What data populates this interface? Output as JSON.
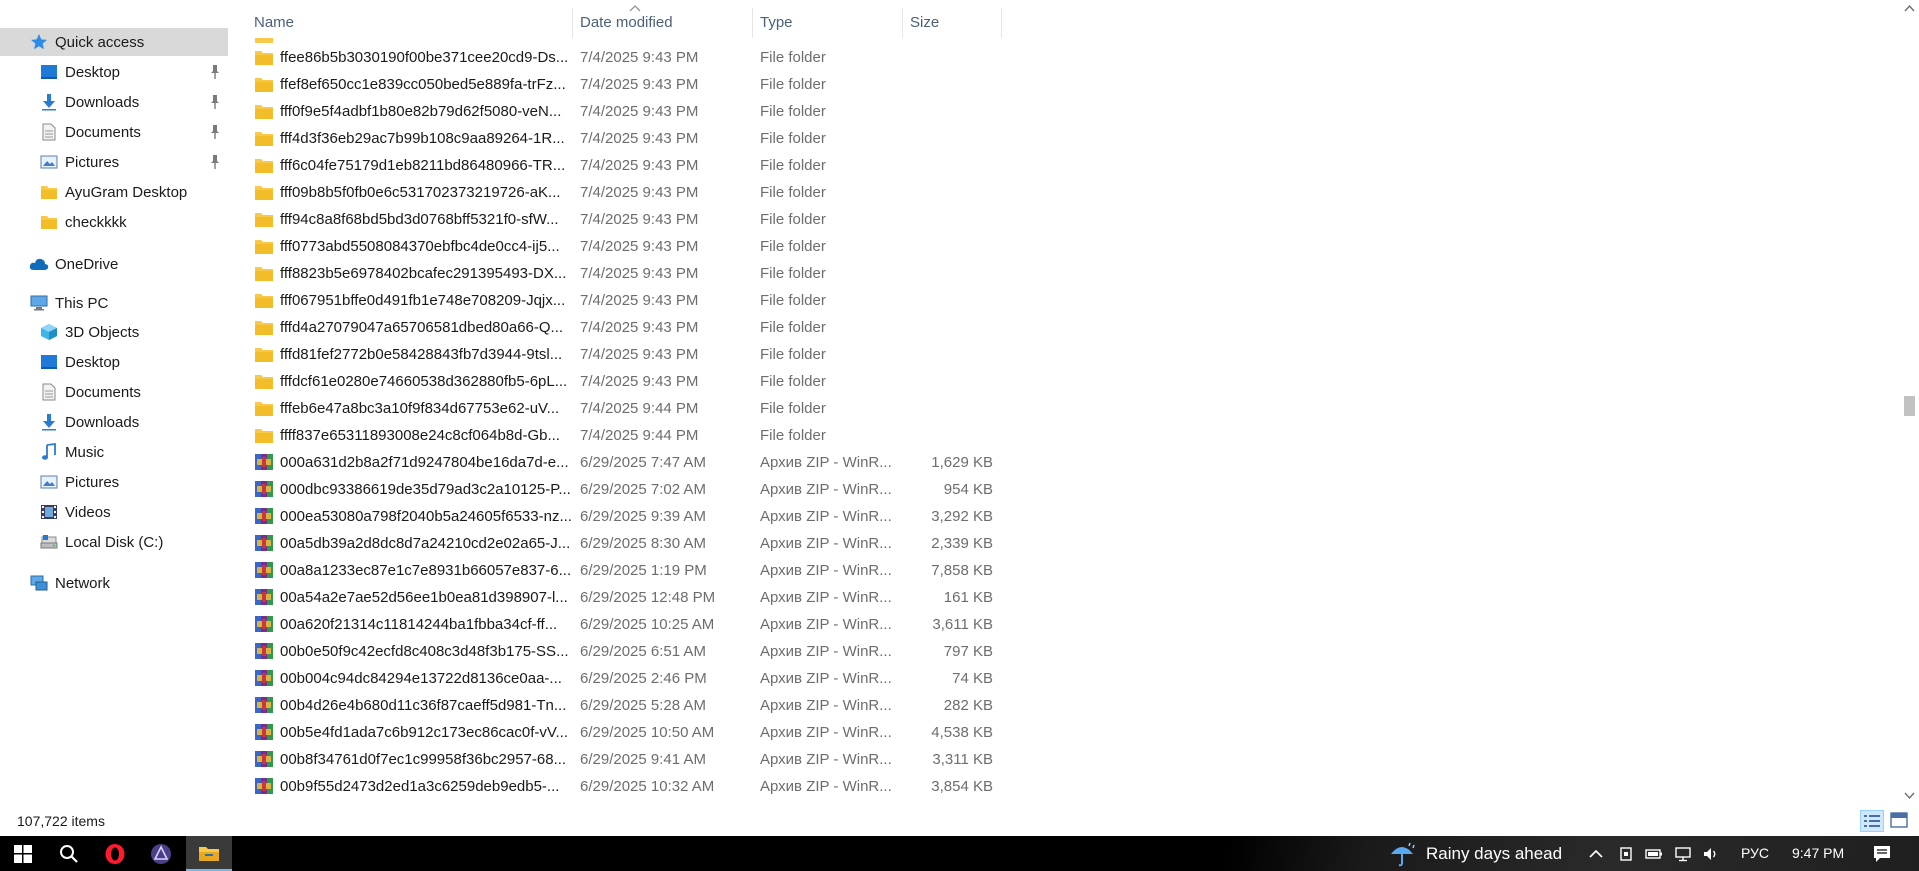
{
  "sidebar": {
    "quick_access": "Quick access",
    "quick_items": [
      {
        "label": "Desktop",
        "icon": "desktop-icon",
        "pinned": true
      },
      {
        "label": "Downloads",
        "icon": "downloads-icon",
        "pinned": true
      },
      {
        "label": "Documents",
        "icon": "documents-icon",
        "pinned": true
      },
      {
        "label": "Pictures",
        "icon": "pictures-icon",
        "pinned": true
      },
      {
        "label": "AyuGram Desktop",
        "icon": "folder-icon",
        "pinned": false
      },
      {
        "label": "checkkkk",
        "icon": "folder-icon",
        "pinned": false
      }
    ],
    "onedrive": "OneDrive",
    "this_pc": "This PC",
    "pc_items": [
      {
        "label": "3D Objects",
        "icon": "3d-objects-icon"
      },
      {
        "label": "Desktop",
        "icon": "desktop-icon"
      },
      {
        "label": "Documents",
        "icon": "documents-icon"
      },
      {
        "label": "Downloads",
        "icon": "downloads-icon"
      },
      {
        "label": "Music",
        "icon": "music-icon"
      },
      {
        "label": "Pictures",
        "icon": "pictures-icon"
      },
      {
        "label": "Videos",
        "icon": "videos-icon"
      },
      {
        "label": "Local Disk (C:)",
        "icon": "disk-icon"
      }
    ],
    "network": "Network"
  },
  "columns": {
    "name": "Name",
    "date": "Date modified",
    "type": "Type",
    "size": "Size"
  },
  "files": [
    {
      "name": "ffee86b5b3030190f00be371cee20cd9-Ds...",
      "date": "7/4/2025 9:43 PM",
      "type": "File folder",
      "size": "",
      "kind": "folder"
    },
    {
      "name": "ffef8ef650cc1e839cc050bed5e889fa-trFz...",
      "date": "7/4/2025 9:43 PM",
      "type": "File folder",
      "size": "",
      "kind": "folder"
    },
    {
      "name": "fff0f9e5f4adbf1b80e82b79d62f5080-veN...",
      "date": "7/4/2025 9:43 PM",
      "type": "File folder",
      "size": "",
      "kind": "folder"
    },
    {
      "name": "fff4d3f36eb29ac7b99b108c9aa89264-1R...",
      "date": "7/4/2025 9:43 PM",
      "type": "File folder",
      "size": "",
      "kind": "folder"
    },
    {
      "name": "fff6c04fe75179d1eb8211bd86480966-TR...",
      "date": "7/4/2025 9:43 PM",
      "type": "File folder",
      "size": "",
      "kind": "folder"
    },
    {
      "name": "fff09b8b5f0fb0e6c531702373219726-aK...",
      "date": "7/4/2025 9:43 PM",
      "type": "File folder",
      "size": "",
      "kind": "folder"
    },
    {
      "name": "fff94c8a8f68bd5bd3d0768bff5321f0-sfW...",
      "date": "7/4/2025 9:43 PM",
      "type": "File folder",
      "size": "",
      "kind": "folder"
    },
    {
      "name": "fff0773abd5508084370ebfbc4de0cc4-ij5...",
      "date": "7/4/2025 9:43 PM",
      "type": "File folder",
      "size": "",
      "kind": "folder"
    },
    {
      "name": "fff8823b5e6978402bcafec291395493-DX...",
      "date": "7/4/2025 9:43 PM",
      "type": "File folder",
      "size": "",
      "kind": "folder"
    },
    {
      "name": "fff067951bffe0d491fb1e748e708209-Jqjx...",
      "date": "7/4/2025 9:43 PM",
      "type": "File folder",
      "size": "",
      "kind": "folder"
    },
    {
      "name": "fffd4a27079047a65706581dbed80a66-Q...",
      "date": "7/4/2025 9:43 PM",
      "type": "File folder",
      "size": "",
      "kind": "folder"
    },
    {
      "name": "fffd81fef2772b0e58428843fb7d3944-9tsl...",
      "date": "7/4/2025 9:43 PM",
      "type": "File folder",
      "size": "",
      "kind": "folder"
    },
    {
      "name": "fffdcf61e0280e74660538d362880fb5-6pL...",
      "date": "7/4/2025 9:43 PM",
      "type": "File folder",
      "size": "",
      "kind": "folder"
    },
    {
      "name": "fffeb6e47a8bc3a10f9f834d67753e62-uV...",
      "date": "7/4/2025 9:44 PM",
      "type": "File folder",
      "size": "",
      "kind": "folder"
    },
    {
      "name": "ffff837e65311893008e24c8cf064b8d-Gb...",
      "date": "7/4/2025 9:44 PM",
      "type": "File folder",
      "size": "",
      "kind": "folder"
    },
    {
      "name": "000a631d2b8a2f71d9247804be16da7d-e...",
      "date": "6/29/2025 7:47 AM",
      "type": "Архив ZIP - WinR...",
      "size": "1,629 KB",
      "kind": "zip"
    },
    {
      "name": "000dbc93386619de35d79ad3c2a10125-P...",
      "date": "6/29/2025 7:02 AM",
      "type": "Архив ZIP - WinR...",
      "size": "954 KB",
      "kind": "zip"
    },
    {
      "name": "000ea53080a798f2040b5a24605f6533-nz...",
      "date": "6/29/2025 9:39 AM",
      "type": "Архив ZIP - WinR...",
      "size": "3,292 KB",
      "kind": "zip"
    },
    {
      "name": "00a5db39a2d8dc8d7a24210cd2e02a65-J...",
      "date": "6/29/2025 8:30 AM",
      "type": "Архив ZIP - WinR...",
      "size": "2,339 KB",
      "kind": "zip"
    },
    {
      "name": "00a8a1233ec87e1c7e8931b66057e837-6...",
      "date": "6/29/2025 1:19 PM",
      "type": "Архив ZIP - WinR...",
      "size": "7,858 KB",
      "kind": "zip"
    },
    {
      "name": "00a54a2e7ae52d56ee1b0ea81d398907-l...",
      "date": "6/29/2025 12:48 PM",
      "type": "Архив ZIP - WinR...",
      "size": "161 KB",
      "kind": "zip"
    },
    {
      "name": "00a620f21314c11814244ba1fbba34cf-ff...",
      "date": "6/29/2025 10:25 AM",
      "type": "Архив ZIP - WinR...",
      "size": "3,611 KB",
      "kind": "zip"
    },
    {
      "name": "00b0e50f9c42ecfd8c408c3d48f3b175-SS...",
      "date": "6/29/2025 6:51 AM",
      "type": "Архив ZIP - WinR...",
      "size": "797 KB",
      "kind": "zip"
    },
    {
      "name": "00b004c94dc84294e13722d8136ce0aa-...",
      "date": "6/29/2025 2:46 PM",
      "type": "Архив ZIP - WinR...",
      "size": "74 KB",
      "kind": "zip"
    },
    {
      "name": "00b4d26e4b680d11c36f87caeff5d981-Tn...",
      "date": "6/29/2025 5:28 AM",
      "type": "Архив ZIP - WinR...",
      "size": "282 KB",
      "kind": "zip"
    },
    {
      "name": "00b5e4fd1ada7c6b912c173ec86cac0f-vV...",
      "date": "6/29/2025 10:50 AM",
      "type": "Архив ZIP - WinR...",
      "size": "4,538 KB",
      "kind": "zip"
    },
    {
      "name": "00b8f34761d0f7ec1c99958f36bc2957-68...",
      "date": "6/29/2025 9:41 AM",
      "type": "Архив ZIP - WinR...",
      "size": "3,311 KB",
      "kind": "zip"
    },
    {
      "name": "00b9f55d2473d2ed1a3c6259deb9edb5-...",
      "date": "6/29/2025 10:32 AM",
      "type": "Архив ZIP - WinR...",
      "size": "3,854 KB",
      "kind": "zip"
    }
  ],
  "status": {
    "item_count": "107,722 items"
  },
  "taskbar": {
    "weather_text": "Rainy days ahead",
    "language": "РУС",
    "time": "9:47 PM"
  },
  "colors": {
    "selected_nav": "#d9d9d9",
    "folder": "#f8c948",
    "taskbar": "#000000",
    "accent": "#76b9ed"
  }
}
